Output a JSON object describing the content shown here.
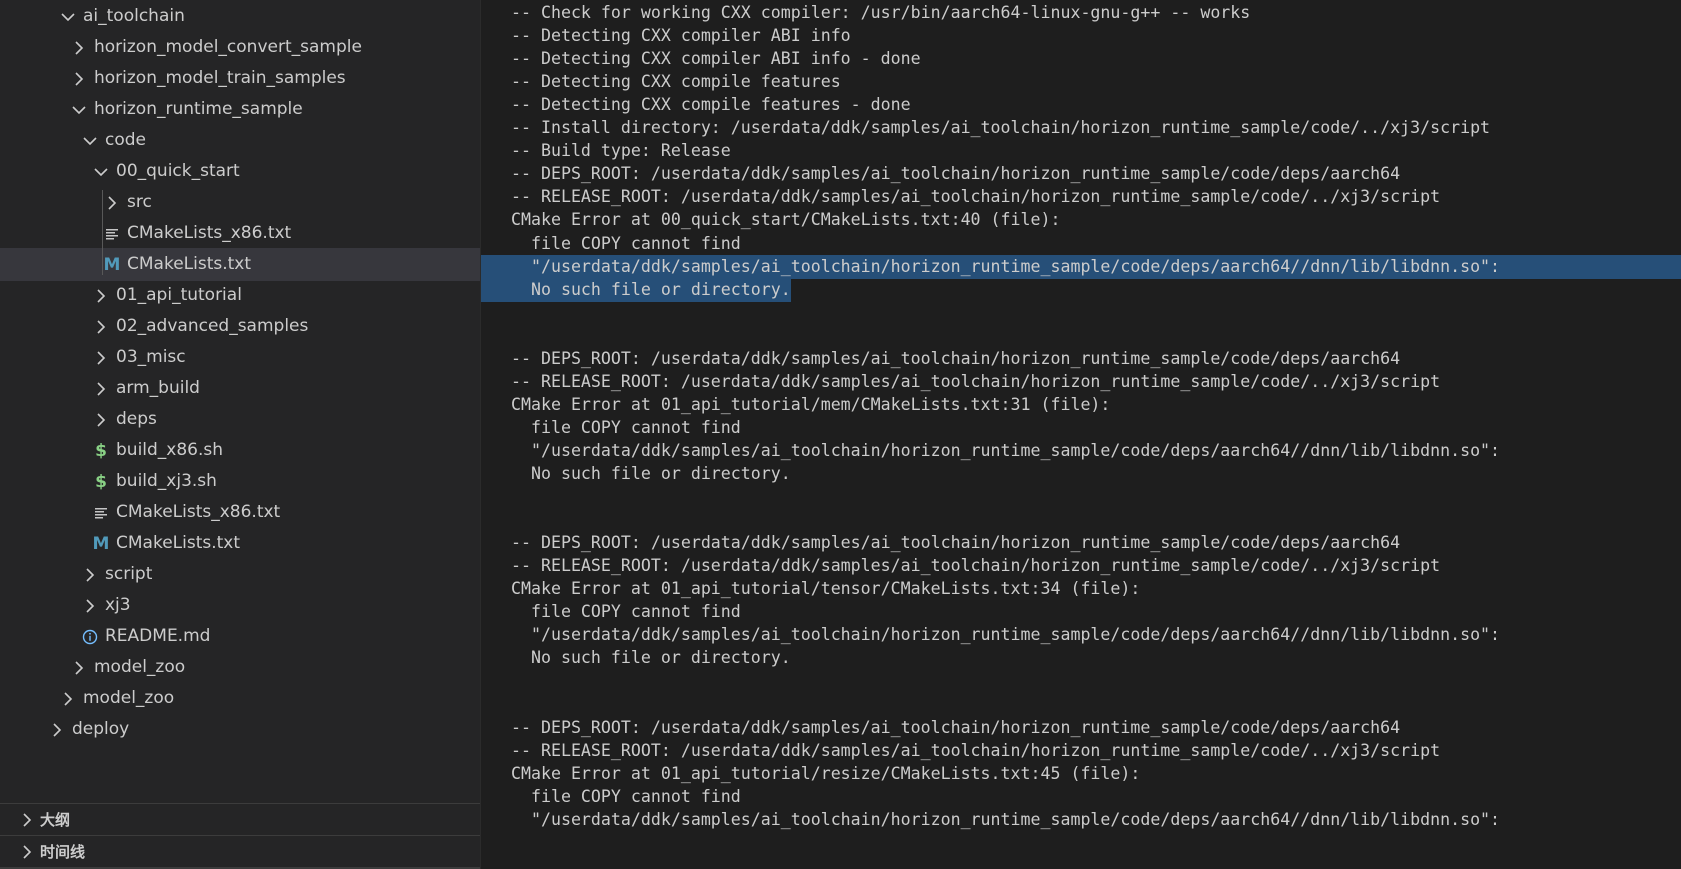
{
  "explorer": {
    "tree": [
      {
        "label": "ai_toolchain",
        "kind": "folder",
        "expanded": true,
        "depth": 0
      },
      {
        "label": "horizon_model_convert_sample",
        "kind": "folder",
        "expanded": false,
        "depth": 1
      },
      {
        "label": "horizon_model_train_samples",
        "kind": "folder",
        "expanded": false,
        "depth": 1
      },
      {
        "label": "horizon_runtime_sample",
        "kind": "folder",
        "expanded": true,
        "depth": 1
      },
      {
        "label": "code",
        "kind": "folder",
        "expanded": true,
        "depth": 2
      },
      {
        "label": "00_quick_start",
        "kind": "folder",
        "expanded": true,
        "depth": 3
      },
      {
        "label": "src",
        "kind": "folder",
        "expanded": false,
        "depth": 4
      },
      {
        "label": "CMakeLists_x86.txt",
        "kind": "text-file",
        "depth": 4
      },
      {
        "label": "CMakeLists.txt",
        "kind": "cmake-file",
        "depth": 4,
        "selected": true
      },
      {
        "label": "01_api_tutorial",
        "kind": "folder",
        "expanded": false,
        "depth": 3
      },
      {
        "label": "02_advanced_samples",
        "kind": "folder",
        "expanded": false,
        "depth": 3
      },
      {
        "label": "03_misc",
        "kind": "folder",
        "expanded": false,
        "depth": 3
      },
      {
        "label": "arm_build",
        "kind": "folder",
        "expanded": false,
        "depth": 3
      },
      {
        "label": "deps",
        "kind": "folder",
        "expanded": false,
        "depth": 3
      },
      {
        "label": "build_x86.sh",
        "kind": "shell-file",
        "depth": 3
      },
      {
        "label": "build_xj3.sh",
        "kind": "shell-file",
        "depth": 3
      },
      {
        "label": "CMakeLists_x86.txt",
        "kind": "text-file",
        "depth": 3
      },
      {
        "label": "CMakeLists.txt",
        "kind": "cmake-file",
        "depth": 3
      },
      {
        "label": "script",
        "kind": "folder",
        "expanded": false,
        "depth": 2
      },
      {
        "label": "xj3",
        "kind": "folder",
        "expanded": false,
        "depth": 2
      },
      {
        "label": "README.md",
        "kind": "info-file",
        "depth": 2
      },
      {
        "label": "model_zoo",
        "kind": "folder",
        "expanded": false,
        "depth": 1
      },
      {
        "label": "model_zoo",
        "kind": "folder",
        "expanded": false,
        "depth": 0
      },
      {
        "label": "deploy",
        "kind": "folder",
        "expanded": false,
        "depth": -1
      }
    ],
    "panels": [
      {
        "label": "大纲"
      },
      {
        "label": "时间线"
      }
    ],
    "icons": {
      "folder_collapsed": "chevron-right-icon",
      "folder_expanded": "chevron-down-icon",
      "text_file": "text-file-icon",
      "cmake_file": "cmake-m-icon",
      "shell_file": "dollar-icon",
      "info_file": "info-icon"
    },
    "colors": {
      "background": "#252526",
      "selected_row": "#37373d",
      "text": "#cccccc",
      "cmake_icon": "#519aba",
      "shell_icon": "#89d185",
      "info_icon": "#75beff"
    }
  },
  "terminal": {
    "colors": {
      "background": "#1e1e1e",
      "text": "#cccccc",
      "selection": "#264f78"
    },
    "lines": [
      {
        "text": "-- Check for working CXX compiler: /usr/bin/aarch64-linux-gnu-g++ -- works"
      },
      {
        "text": "-- Detecting CXX compiler ABI info"
      },
      {
        "text": "-- Detecting CXX compiler ABI info - done"
      },
      {
        "text": "-- Detecting CXX compile features"
      },
      {
        "text": "-- Detecting CXX compile features - done"
      },
      {
        "text": "-- Install directory: /userdata/ddk/samples/ai_toolchain/horizon_runtime_sample/code/../xj3/script"
      },
      {
        "text": "-- Build type: Release"
      },
      {
        "text": "-- DEPS_ROOT: /userdata/ddk/samples/ai_toolchain/horizon_runtime_sample/code/deps/aarch64"
      },
      {
        "text": "-- RELEASE_ROOT: /userdata/ddk/samples/ai_toolchain/horizon_runtime_sample/code/../xj3/script"
      },
      {
        "text": "CMake Error at 00_quick_start/CMakeLists.txt:40 (file):"
      },
      {
        "text": "  file COPY cannot find"
      },
      {
        "text": "  \"/userdata/ddk/samples/ai_toolchain/horizon_runtime_sample/code/deps/aarch64//dnn/lib/libdnn.so\":",
        "selected": "full"
      },
      {
        "text": "  No such file or directory.",
        "selected": "partial"
      },
      {
        "text": ""
      },
      {
        "text": ""
      },
      {
        "text": "-- DEPS_ROOT: /userdata/ddk/samples/ai_toolchain/horizon_runtime_sample/code/deps/aarch64"
      },
      {
        "text": "-- RELEASE_ROOT: /userdata/ddk/samples/ai_toolchain/horizon_runtime_sample/code/../xj3/script"
      },
      {
        "text": "CMake Error at 01_api_tutorial/mem/CMakeLists.txt:31 (file):"
      },
      {
        "text": "  file COPY cannot find"
      },
      {
        "text": "  \"/userdata/ddk/samples/ai_toolchain/horizon_runtime_sample/code/deps/aarch64//dnn/lib/libdnn.so\":"
      },
      {
        "text": "  No such file or directory."
      },
      {
        "text": ""
      },
      {
        "text": ""
      },
      {
        "text": "-- DEPS_ROOT: /userdata/ddk/samples/ai_toolchain/horizon_runtime_sample/code/deps/aarch64"
      },
      {
        "text": "-- RELEASE_ROOT: /userdata/ddk/samples/ai_toolchain/horizon_runtime_sample/code/../xj3/script"
      },
      {
        "text": "CMake Error at 01_api_tutorial/tensor/CMakeLists.txt:34 (file):"
      },
      {
        "text": "  file COPY cannot find"
      },
      {
        "text": "  \"/userdata/ddk/samples/ai_toolchain/horizon_runtime_sample/code/deps/aarch64//dnn/lib/libdnn.so\":"
      },
      {
        "text": "  No such file or directory."
      },
      {
        "text": ""
      },
      {
        "text": ""
      },
      {
        "text": "-- DEPS_ROOT: /userdata/ddk/samples/ai_toolchain/horizon_runtime_sample/code/deps/aarch64"
      },
      {
        "text": "-- RELEASE_ROOT: /userdata/ddk/samples/ai_toolchain/horizon_runtime_sample/code/../xj3/script"
      },
      {
        "text": "CMake Error at 01_api_tutorial/resize/CMakeLists.txt:45 (file):"
      },
      {
        "text": "  file COPY cannot find"
      },
      {
        "text": "  \"/userdata/ddk/samples/ai_toolchain/horizon_runtime_sample/code/deps/aarch64//dnn/lib/libdnn.so\":"
      }
    ]
  }
}
